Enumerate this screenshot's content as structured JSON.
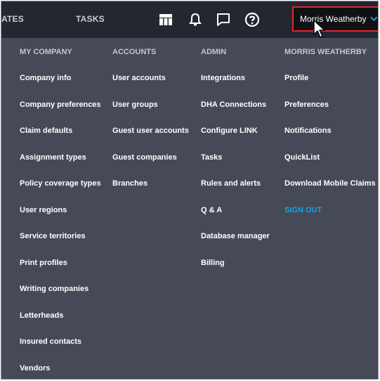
{
  "topnav": {
    "items": [
      {
        "label": "ATES"
      },
      {
        "label": "TASKS"
      }
    ],
    "icons": [
      "table-icon",
      "bell-icon",
      "chat-icon",
      "help-icon"
    ],
    "user_name": "Morris Weatherby"
  },
  "menu": {
    "columns": [
      {
        "header": "MY COMPANY",
        "items": [
          "Company info",
          "Company preferences",
          "Claim defaults",
          "Assignment types",
          "Policy coverage types",
          "User regions",
          "Service territories",
          "Print profiles",
          "Writing companies",
          "Letterheads",
          "Insured contacts",
          "Vendors"
        ]
      },
      {
        "header": "ACCOUNTS",
        "items": [
          "User accounts",
          "User groups",
          "Guest user accounts",
          "Guest companies",
          "Branches"
        ]
      },
      {
        "header": "ADMIN",
        "items": [
          "Integrations",
          "DHA Connections",
          "Configure LINK",
          "Tasks",
          "Rules and alerts",
          "Q & A",
          "Database manager",
          "Billing"
        ]
      },
      {
        "header": "MORRIS WEATHERBY",
        "items": [
          "Profile",
          "Preferences",
          "Notifications",
          "QuickList",
          "Download Mobile Claims",
          "SIGN OUT"
        ]
      }
    ]
  },
  "colors": {
    "topbar": "#24272f",
    "menu_bg": "#454a56",
    "highlight_border": "#e0262b",
    "signout": "#1aa3e6"
  }
}
